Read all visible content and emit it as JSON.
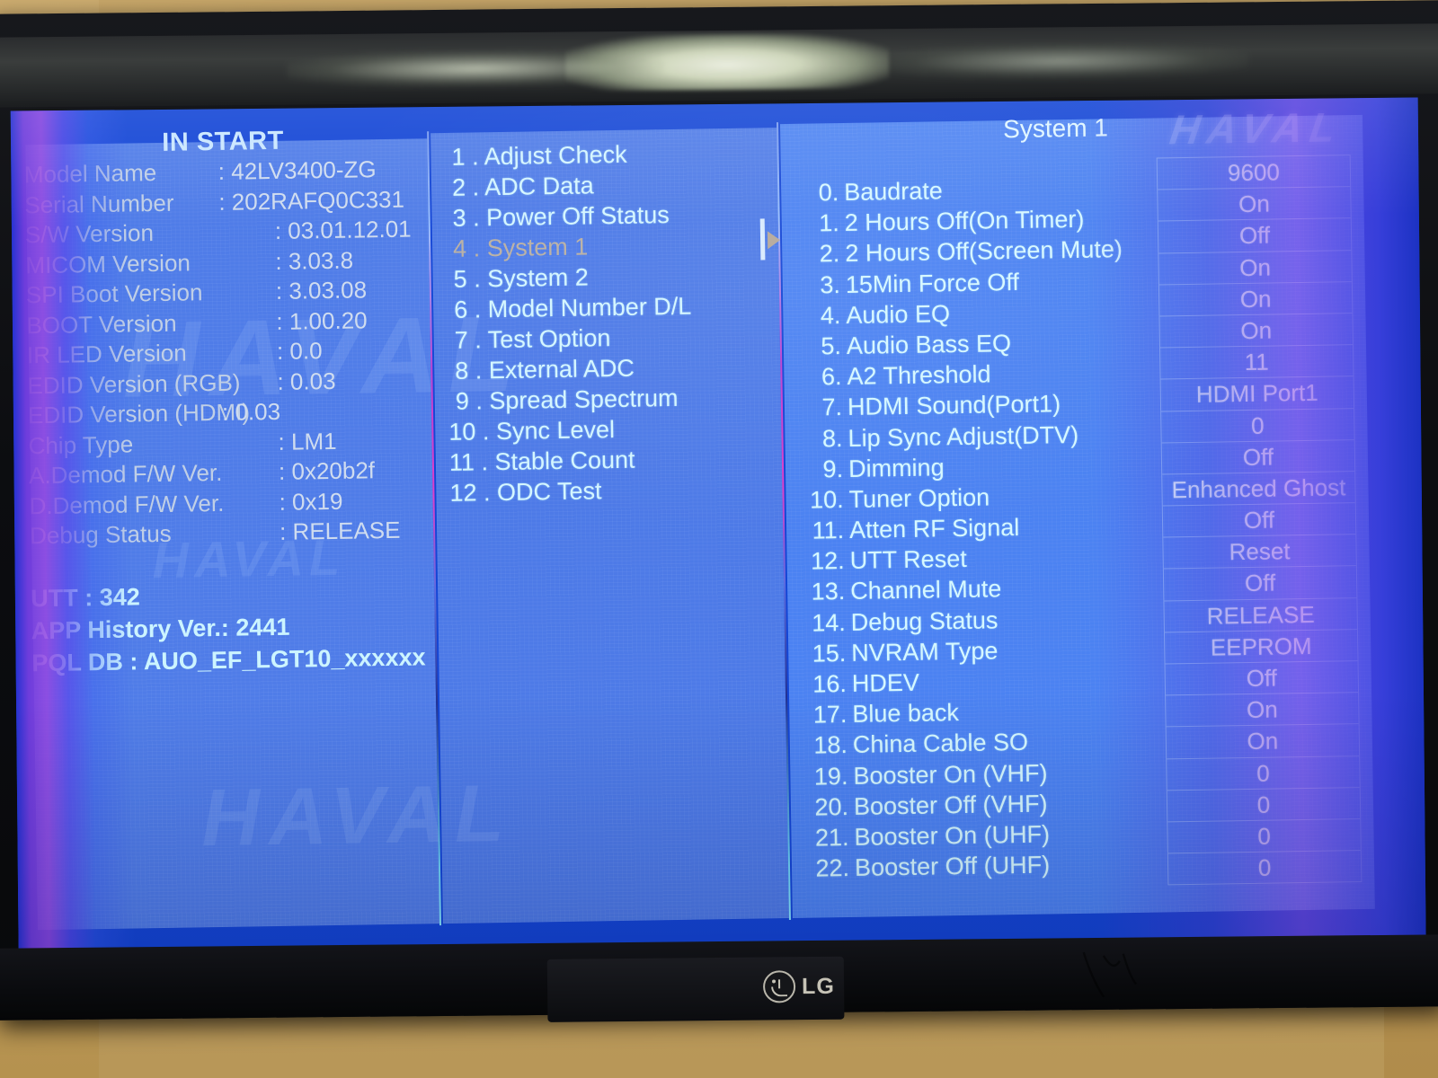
{
  "device": {
    "brand_logo": "LG",
    "screen_watermark": "HAVAL"
  },
  "left_panel": {
    "title": "IN START",
    "info_rows": [
      {
        "label": "Model Name",
        "value": ": 42LV3400-ZG",
        "align": "wide"
      },
      {
        "label": "Serial Number",
        "value": ": 202RAFQ0C331",
        "align": "wide"
      },
      {
        "label": "S/W Version",
        "value": ": 03.01.12.01",
        "align": "narrow"
      },
      {
        "label": "MICOM Version",
        "value": ": 3.03.8",
        "align": "narrow"
      },
      {
        "label": "SPI Boot Version",
        "value": ": 3.03.08",
        "align": "narrow"
      },
      {
        "label": "BOOT Version",
        "value": ": 1.00.20",
        "align": "narrow"
      },
      {
        "label": "IR LED Version",
        "value": ": 0.0",
        "align": "narrow"
      },
      {
        "label": "EDID Version (RGB)",
        "value": ": 0.03",
        "align": "narrow"
      },
      {
        "label": "EDID Version (HDMI)",
        "value": ": 0.03",
        "align": "wide"
      },
      {
        "label": "Chip Type",
        "value": ": LM1",
        "align": "narrow"
      },
      {
        "label": "A.Demod F/W Ver.",
        "value": ": 0x20b2f",
        "align": "narrow"
      },
      {
        "label": "D.Demod F/W Ver.",
        "value": ": 0x19",
        "align": "narrow"
      },
      {
        "label": "Debug Status",
        "value": ": RELEASE",
        "align": "narrow"
      }
    ],
    "extra_rows": [
      "UTT : 342",
      "APP History Ver.: 2441",
      "PQL DB : AUO_EF_LGT10_xxxxxx"
    ]
  },
  "middle_menu": {
    "selected_index": 3,
    "items": [
      {
        "num": "1 .",
        "label": "Adjust Check"
      },
      {
        "num": "2 .",
        "label": "ADC Data"
      },
      {
        "num": "3 .",
        "label": "Power Off Status"
      },
      {
        "num": "4 .",
        "label": "System 1"
      },
      {
        "num": "5 .",
        "label": "System 2"
      },
      {
        "num": "6 .",
        "label": "Model Number D/L"
      },
      {
        "num": "7 .",
        "label": "Test Option"
      },
      {
        "num": "8 .",
        "label": "External ADC"
      },
      {
        "num": "9 .",
        "label": "Spread Spectrum"
      },
      {
        "num": "10 .",
        "label": "Sync Level"
      },
      {
        "num": "11 .",
        "label": "Stable Count"
      },
      {
        "num": "12 .",
        "label": "ODC Test"
      }
    ]
  },
  "right_panel": {
    "title": "System 1",
    "rows": [
      {
        "num": "0.",
        "label": "Baudrate",
        "value": "9600"
      },
      {
        "num": "1.",
        "label": "2 Hours Off(On Timer)",
        "value": "On"
      },
      {
        "num": "2.",
        "label": "2 Hours Off(Screen Mute)",
        "value": "Off"
      },
      {
        "num": "3.",
        "label": "15Min Force Off",
        "value": "On"
      },
      {
        "num": "4.",
        "label": "Audio EQ",
        "value": "On"
      },
      {
        "num": "5.",
        "label": "Audio Bass EQ",
        "value": "On"
      },
      {
        "num": "6.",
        "label": "A2 Threshold",
        "value": "11"
      },
      {
        "num": "7.",
        "label": "HDMI Sound(Port1)",
        "value": "HDMI Port1"
      },
      {
        "num": "8.",
        "label": "Lip Sync Adjust(DTV)",
        "value": "0"
      },
      {
        "num": "9.",
        "label": "Dimming",
        "value": "Off"
      },
      {
        "num": "10.",
        "label": "Tuner Option",
        "value": "Enhanced Ghost"
      },
      {
        "num": "11.",
        "label": "Atten RF Signal",
        "value": "Off"
      },
      {
        "num": "12.",
        "label": "UTT Reset",
        "value": "Reset"
      },
      {
        "num": "13.",
        "label": "Channel Mute",
        "value": "Off"
      },
      {
        "num": "14.",
        "label": "Debug Status",
        "value": "RELEASE"
      },
      {
        "num": "15.",
        "label": "NVRAM Type",
        "value": "EEPROM"
      },
      {
        "num": "16.",
        "label": "HDEV",
        "value": "Off"
      },
      {
        "num": "17.",
        "label": "Blue back",
        "value": "On"
      },
      {
        "num": "18.",
        "label": "China Cable SO",
        "value": "On"
      },
      {
        "num": "19.",
        "label": "Booster On (VHF)",
        "value": "0"
      },
      {
        "num": "20.",
        "label": "Booster Off (VHF)",
        "value": "0"
      },
      {
        "num": "21.",
        "label": "Booster On (UHF)",
        "value": "0"
      },
      {
        "num": "22.",
        "label": "Booster Off (UHF)",
        "value": "0"
      }
    ]
  },
  "colors": {
    "panel_left": "#4f7ce8",
    "panel_mid": "#4d7ae7",
    "panel_right": "#4b82f2",
    "text_cyan": "#d4f6ff",
    "text_dim": "#c0cfe6",
    "selected": "#b9b0a4",
    "grid_border": "#86b4f7"
  }
}
